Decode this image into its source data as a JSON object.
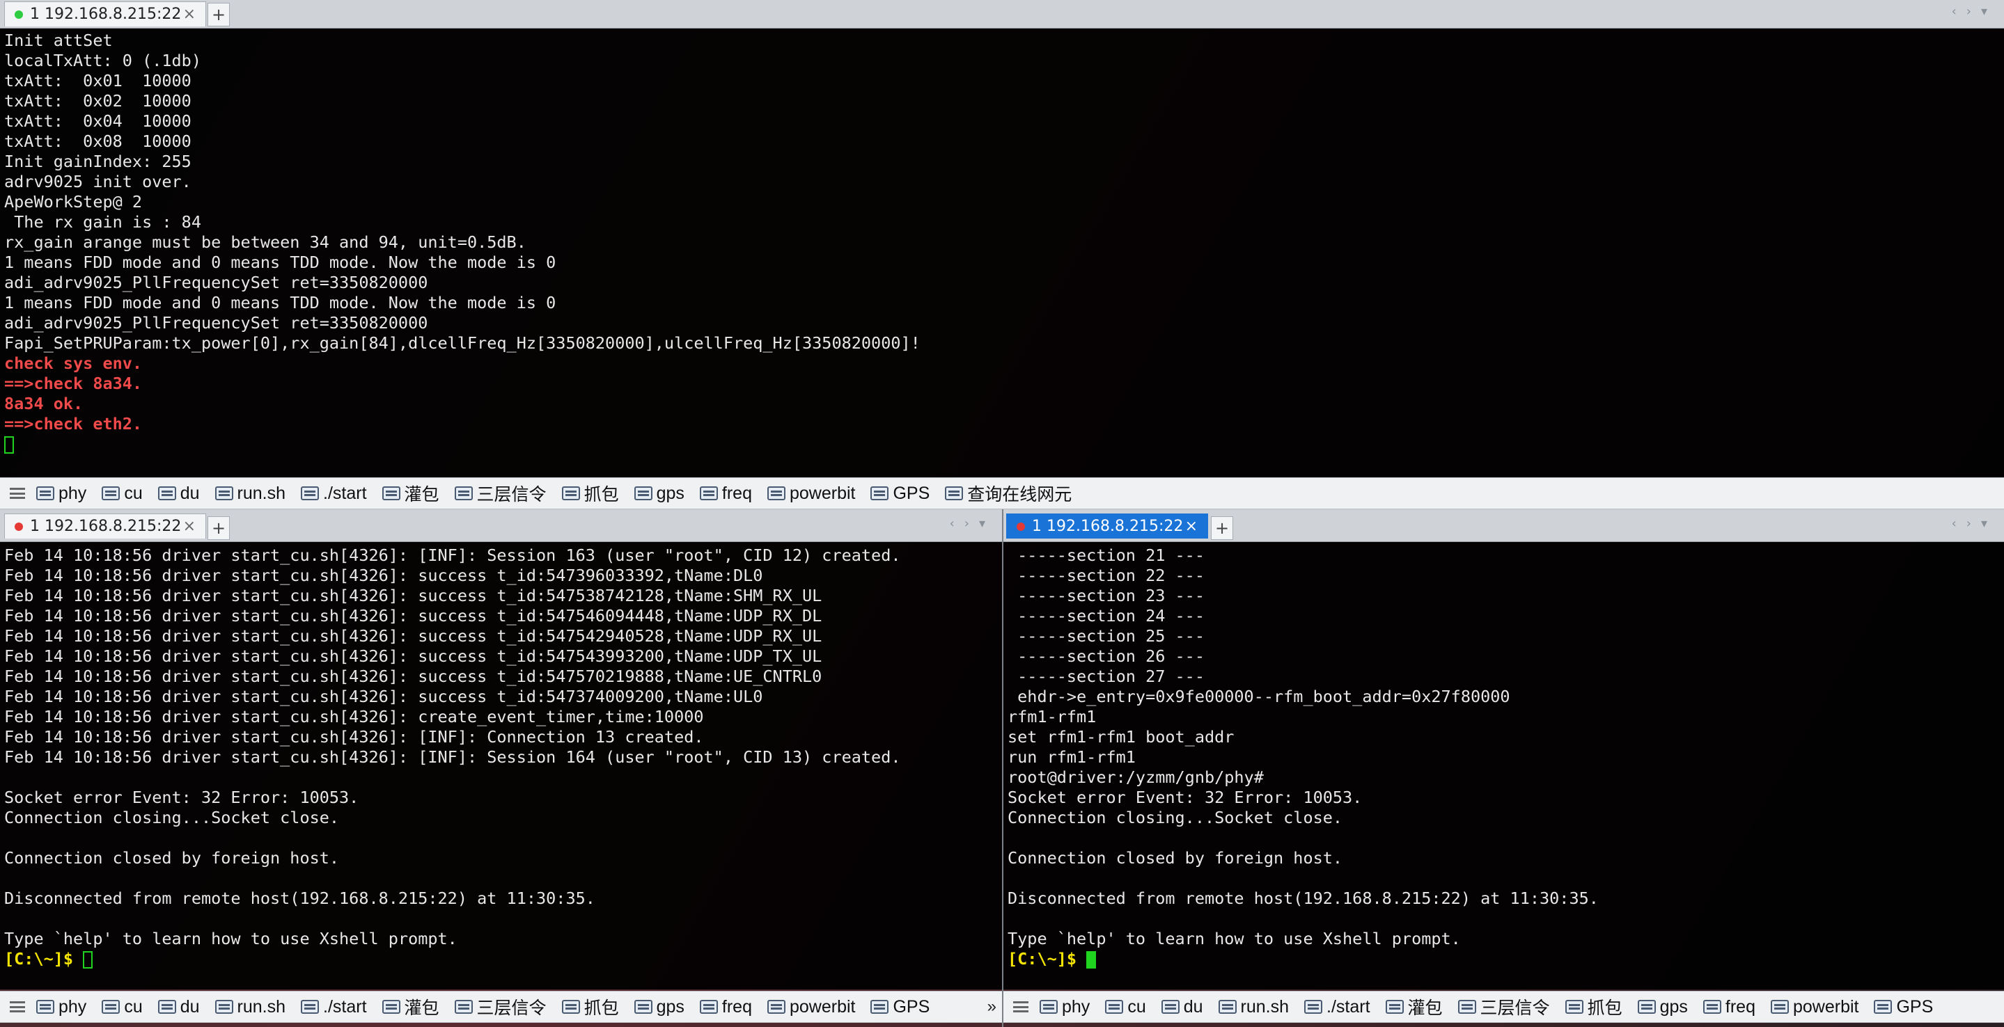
{
  "colors": {
    "accent_tab": "#1a73d6",
    "red_text": "#f04a4a",
    "yellow_text": "#f5e400",
    "cursor": "#1fd31f",
    "terminal_bg": "#000000"
  },
  "top_pane": {
    "tab": {
      "label": "1 192.168.8.215:22",
      "status_color": "#2ecc40",
      "close": "×"
    },
    "add_tab": "+",
    "lines": [
      {
        "t": "Init attSet"
      },
      {
        "t": "localTxAtt: 0 (.1db)"
      },
      {
        "t": "txAtt:  0x01  10000"
      },
      {
        "t": "txAtt:  0x02  10000"
      },
      {
        "t": "txAtt:  0x04  10000"
      },
      {
        "t": "txAtt:  0x08  10000"
      },
      {
        "t": "Init gainIndex: 255"
      },
      {
        "t": "adrv9025 init over."
      },
      {
        "t": "ApeWorkStep@ 2"
      },
      {
        "t": " The rx gain is : 84"
      },
      {
        "t": "rx_gain arange must be between 34 and 94, unit=0.5dB."
      },
      {
        "t": "1 means FDD mode and 0 means TDD mode. Now the mode is 0"
      },
      {
        "t": "adi_adrv9025_PllFrequencySet ret=3350820000"
      },
      {
        "t": "1 means FDD mode and 0 means TDD mode. Now the mode is 0"
      },
      {
        "t": "adi_adrv9025_PllFrequencySet ret=3350820000"
      },
      {
        "t": "Fapi_SetPRUParam:tx_power[0],rx_gain[84],dlcellFreq_Hz[3350820000],ulcellFreq_Hz[3350820000]!"
      },
      {
        "t": "check sys env.",
        "c": "red"
      },
      {
        "t": "==>check 8a34.",
        "c": "red"
      },
      {
        "t": "8a34 ok.",
        "c": "red"
      },
      {
        "t": "==>check eth2.",
        "c": "red"
      }
    ]
  },
  "top_buttons": [
    "phy",
    "cu",
    "du",
    "run.sh",
    "./start",
    "灌包",
    "三层信令",
    "抓包",
    "gps",
    "freq",
    "powerbit",
    "GPS",
    "查询在线网元"
  ],
  "left_pane": {
    "tab": {
      "label": "1 192.168.8.215:22",
      "status_color": "#e53935",
      "close": "×"
    },
    "add_tab": "+",
    "lines": [
      "Feb 14 10:18:56 driver start_cu.sh[4326]: [INF]: Session 163 (user \"root\", CID 12) created.",
      "Feb 14 10:18:56 driver start_cu.sh[4326]: success t_id:547396033392,tName:DL0",
      "Feb 14 10:18:56 driver start_cu.sh[4326]: success t_id:547538742128,tName:SHM_RX_UL",
      "Feb 14 10:18:56 driver start_cu.sh[4326]: success t_id:547546094448,tName:UDP_RX_DL",
      "Feb 14 10:18:56 driver start_cu.sh[4326]: success t_id:547542940528,tName:UDP_RX_UL",
      "Feb 14 10:18:56 driver start_cu.sh[4326]: success t_id:547543993200,tName:UDP_TX_UL",
      "Feb 14 10:18:56 driver start_cu.sh[4326]: success t_id:547570219888,tName:UE_CNTRL0",
      "Feb 14 10:18:56 driver start_cu.sh[4326]: success t_id:547374009200,tName:UL0",
      "Feb 14 10:18:56 driver start_cu.sh[4326]: create_event_timer,time:10000",
      "Feb 14 10:18:56 driver start_cu.sh[4326]: [INF]: Connection 13 created.",
      "Feb 14 10:18:56 driver start_cu.sh[4326]: [INF]: Session 164 (user \"root\", CID 13) created.",
      "",
      "Socket error Event: 32 Error: 10053.",
      "Connection closing...Socket close.",
      "",
      "Connection closed by foreign host.",
      "",
      "Disconnected from remote host(192.168.8.215:22) at 11:30:35.",
      "",
      "Type `help' to learn how to use Xshell prompt."
    ],
    "prompt": "[C:\\~]$ "
  },
  "right_pane": {
    "tab": {
      "label": "1 192.168.8.215:22",
      "status_color": "#e53935",
      "close": "×"
    },
    "add_tab": "+",
    "lines": [
      " -----section 21 ---",
      " -----section 22 ---",
      " -----section 23 ---",
      " -----section 24 ---",
      " -----section 25 ---",
      " -----section 26 ---",
      " -----section 27 ---",
      " ehdr->e_entry=0x9fe00000--rfm_boot_addr=0x27f80000",
      "rfm1-rfm1",
      "set rfm1-rfm1 boot_addr",
      "run rfm1-rfm1",
      "root@driver:/yzmm/gnb/phy#",
      "Socket error Event: 32 Error: 10053.",
      "Connection closing...Socket close.",
      "",
      "Connection closed by foreign host.",
      "",
      "Disconnected from remote host(192.168.8.215:22) at 11:30:35.",
      "",
      "Type `help' to learn how to use Xshell prompt."
    ],
    "prompt": "[C:\\~]$ "
  },
  "bottom_left_buttons": [
    "phy",
    "cu",
    "du",
    "run.sh",
    "./start",
    "灌包",
    "三层信令",
    "抓包",
    "gps",
    "freq",
    "powerbit",
    "GPS"
  ],
  "bottom_right_buttons": [
    "phy",
    "cu",
    "du",
    "run.sh",
    "./start",
    "灌包",
    "三层信令",
    "抓包",
    "gps",
    "freq",
    "powerbit",
    "GPS"
  ],
  "more_glyph": "»",
  "icons": {
    "menu": "hamburger-menu-icon",
    "button": "quick-command-icon",
    "add": "plus-icon",
    "close": "close-icon"
  }
}
